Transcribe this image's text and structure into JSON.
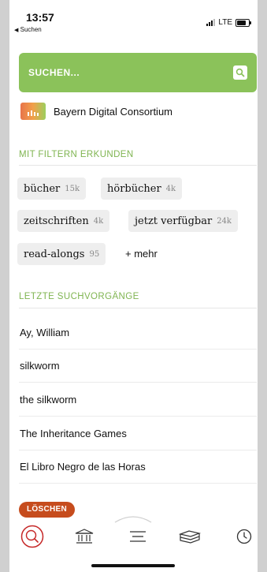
{
  "status_bar": {
    "time": "13:57",
    "back_label": "Suchen",
    "network": "LTE"
  },
  "search": {
    "placeholder": "SUCHEN...",
    "icon": "search-icon",
    "color": "#8bc25a"
  },
  "library": {
    "name": "Bayern Digital Consortium"
  },
  "filters": {
    "heading": "MIT FILTERN ERKUNDEN",
    "chips": [
      {
        "label": "bücher",
        "count": "15k"
      },
      {
        "label": "hörbücher",
        "count": "4k"
      },
      {
        "label": "zeitschriften",
        "count": "4k"
      },
      {
        "label": "jetzt verfügbar",
        "count": "24k"
      },
      {
        "label": "read-alongs",
        "count": "95"
      }
    ],
    "more": "+ mehr"
  },
  "recent": {
    "heading": "LETZTE SUCHVORGÄNGE",
    "items": [
      "Ay, William",
      "silkworm",
      "the silkworm",
      "The Inheritance Games",
      "El Libro Negro de las Horas"
    ],
    "clear_label": "LÖSCHEN"
  },
  "tabbar": {
    "items": [
      "search-icon",
      "library-icon",
      "menu-icon",
      "shelf-icon",
      "clock-icon"
    ],
    "active_color": "#c62828"
  }
}
